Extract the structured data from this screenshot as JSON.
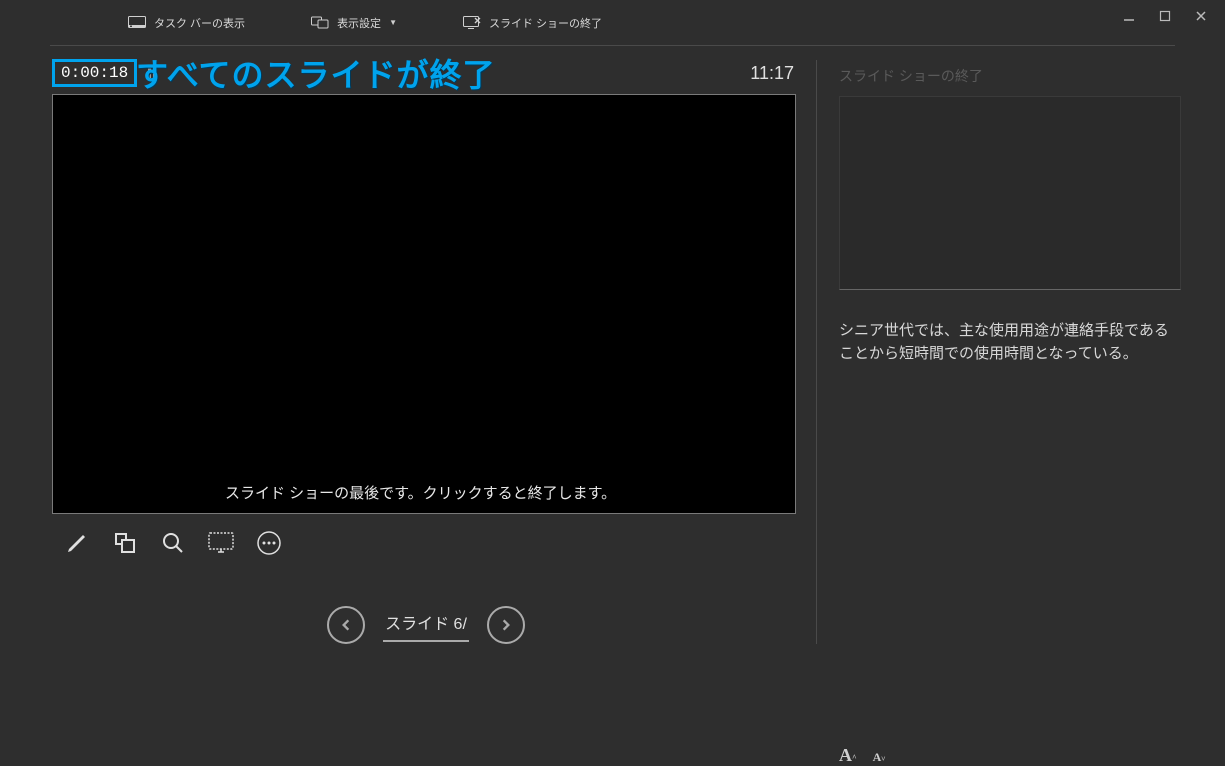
{
  "menu": {
    "taskbar_label": "タスク バーの表示",
    "display_settings_label": "表示設定",
    "end_slideshow_label": "スライド ショーの終了"
  },
  "timer": {
    "elapsed": "0:00:18",
    "clock": "11:17"
  },
  "annotation": {
    "text": "すべてのスライドが終了"
  },
  "slide": {
    "end_message": "スライド ショーの最後です。クリックすると終了します。",
    "indicator": "スライド 6/"
  },
  "next": {
    "title": "スライド ショーの終了",
    "notes": "シニア世代では、主な使用用途が連絡手段であることから短時間での使用時間となっている。"
  },
  "icons": {
    "taskbar": "taskbar-icon",
    "display": "display-icon",
    "end": "end-slideshow-icon"
  }
}
